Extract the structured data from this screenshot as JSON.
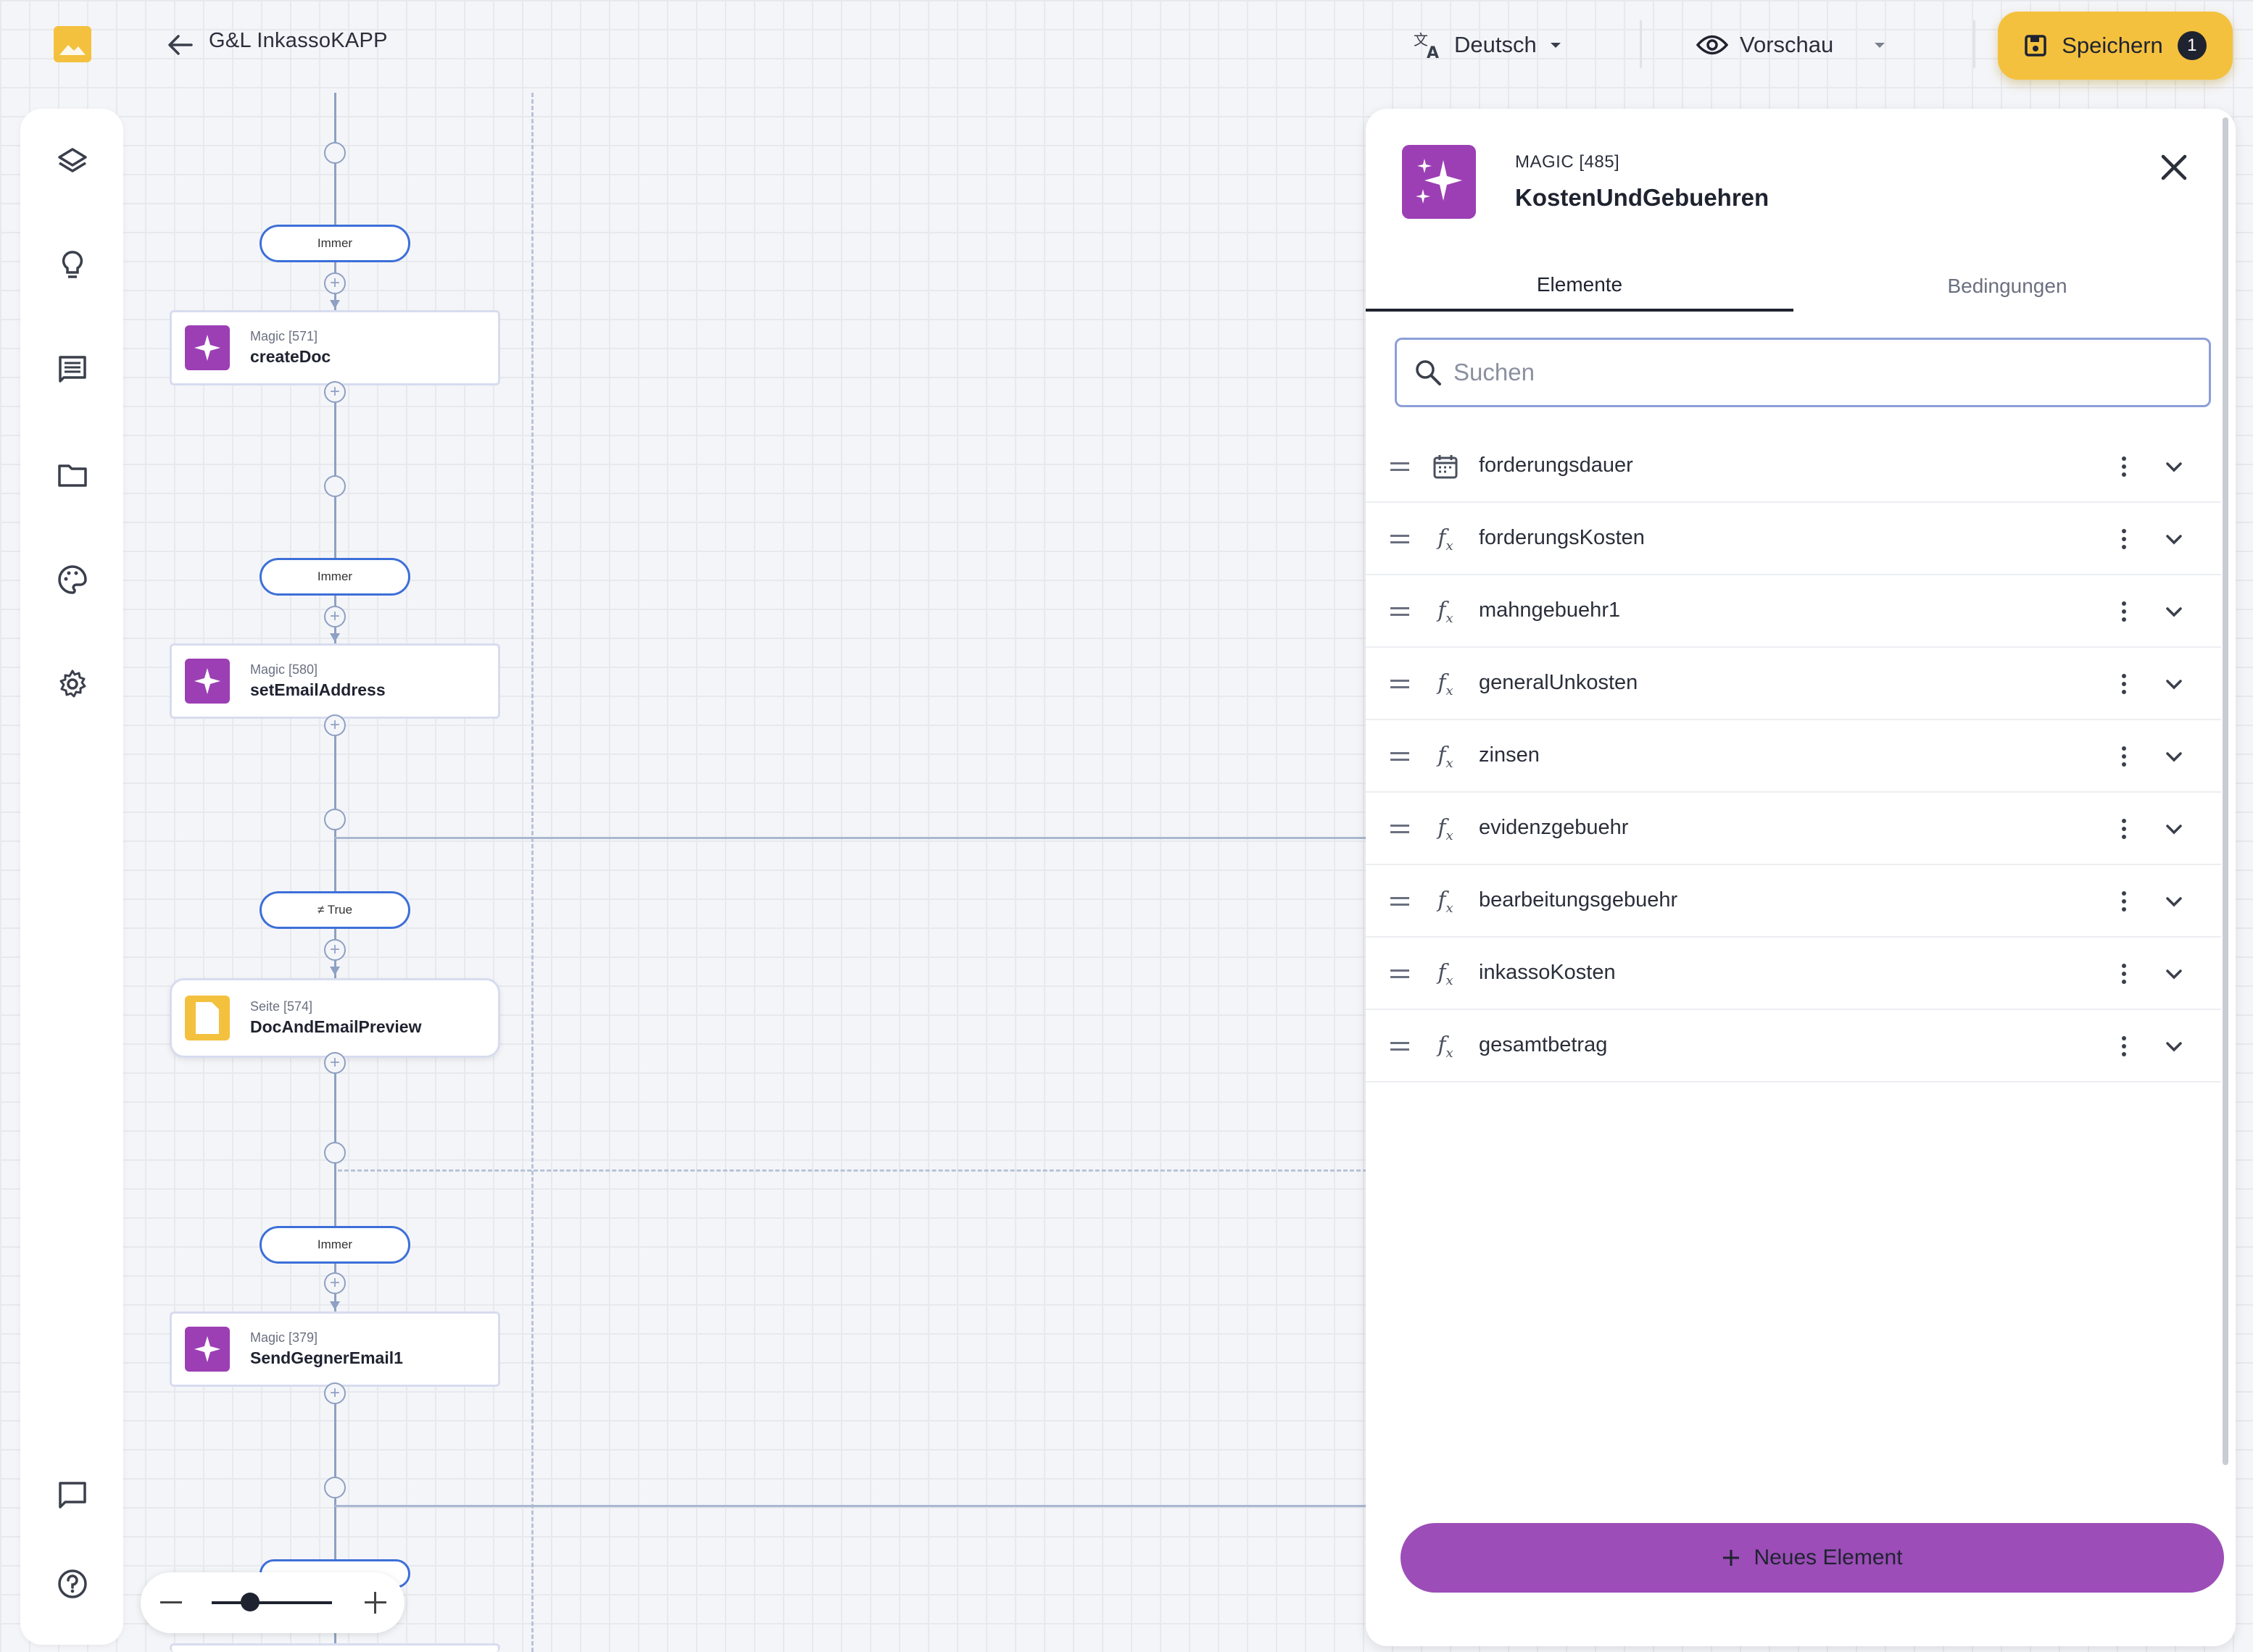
{
  "header": {
    "app_title": "G&L InkassoKAPP",
    "language": "Deutsch",
    "preview": "Vorschau",
    "save_label": "Speichern",
    "save_count": "1"
  },
  "sidebar": {
    "items": [
      "layers-icon",
      "lightbulb-icon",
      "comments-icon",
      "folder-icon",
      "palette-icon",
      "gear-icon"
    ],
    "bottom_items": [
      "chat-icon",
      "help-icon"
    ]
  },
  "flow": {
    "conditions": [
      "Immer",
      "Immer",
      "≠ True",
      "Immer"
    ],
    "nodes": [
      {
        "type": "Magic [571]",
        "name": "createDoc"
      },
      {
        "type": "Magic [580]",
        "name": "setEmailAddress"
      },
      {
        "type": "Seite [574]",
        "name": "DocAndEmailPreview"
      },
      {
        "type": "Magic [379]",
        "name": "SendGegnerEmail1"
      }
    ]
  },
  "zoom": {
    "level": 0.3
  },
  "panel": {
    "subtitle": "MAGIC [485]",
    "title": "KostenUndGebuehren",
    "tabs": [
      "Elemente",
      "Bedingungen"
    ],
    "active_tab": "Elemente",
    "search_placeholder": "Suchen",
    "elements": [
      {
        "icon": "calendar-icon",
        "label": "forderungsdauer"
      },
      {
        "icon": "function-icon",
        "label": "forderungsKosten"
      },
      {
        "icon": "function-icon",
        "label": "mahngebuehr1"
      },
      {
        "icon": "function-icon",
        "label": "generalUnkosten"
      },
      {
        "icon": "function-icon",
        "label": "zinsen"
      },
      {
        "icon": "function-icon",
        "label": "evidenzgebuehr"
      },
      {
        "icon": "function-icon",
        "label": "bearbeitungsgebuehr"
      },
      {
        "icon": "function-icon",
        "label": "inkassoKosten"
      },
      {
        "icon": "function-icon",
        "label": "gesamtbetrag"
      }
    ],
    "new_element": "Neues Element"
  },
  "colors": {
    "accent_yellow": "#f4c13e",
    "magic_purple": "#9c3fb4",
    "button_purple": "#9c4db7",
    "condition_blue": "#3d6fd8"
  }
}
